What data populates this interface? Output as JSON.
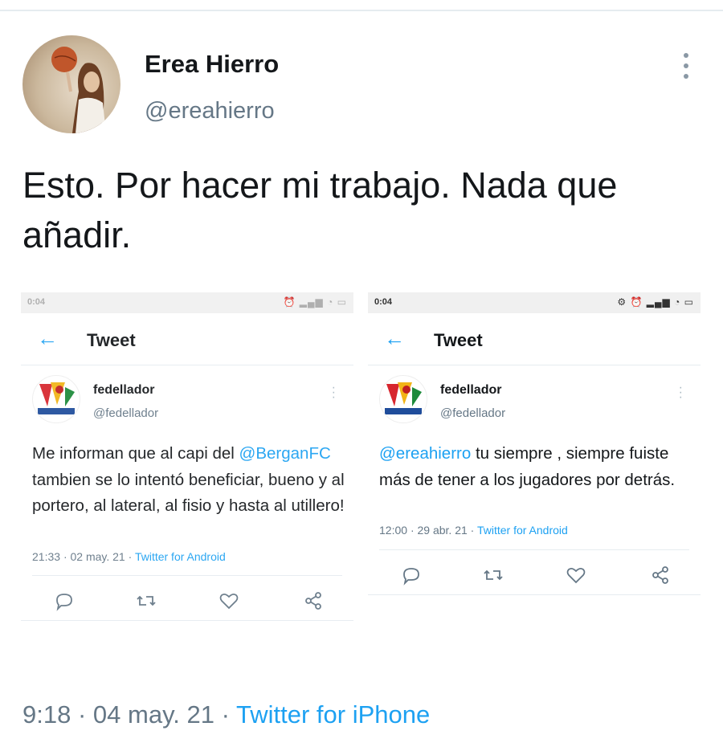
{
  "author": {
    "display_name": "Erea Hierro",
    "handle": "@ereahierro"
  },
  "tweet": {
    "text": "Esto. Por hacer mi trabajo. Nada que añadir.",
    "time": "9:18",
    "date": "04 may. 21",
    "source": "Twitter for iPhone",
    "separator": "·"
  },
  "screenshots": [
    {
      "status_time": "0:04",
      "header_title": "Tweet",
      "author_name": "fedellador",
      "author_handle": "@fedellador",
      "text_part1": "Me informan que al capi del ",
      "mention": "@BerganFC",
      "text_part2": " tambien se lo intentó beneficiar, bueno y al portero, al lateral, al fisio y hasta al utillero!",
      "time": "21:33",
      "date": "02 may. 21",
      "source": "Twitter for Android",
      "separator": "·"
    },
    {
      "status_time": "0:04",
      "header_title": "Tweet",
      "author_name": "fedellador",
      "author_handle": "@fedellador",
      "mention": "@ereahierro",
      "text_part2": " tu siempre , siempre fuiste más de tener a los jugadores por detrás.",
      "time": "12:00",
      "date": "29 abr. 21",
      "source": "Twitter for Android",
      "separator": "·"
    }
  ],
  "icons": [
    "more-icon",
    "back-arrow-icon",
    "reply-icon",
    "retweet-icon",
    "like-icon",
    "share-icon"
  ],
  "colors": {
    "link": "#1da1f2",
    "secondary_text": "#657786",
    "text": "#14171a"
  }
}
